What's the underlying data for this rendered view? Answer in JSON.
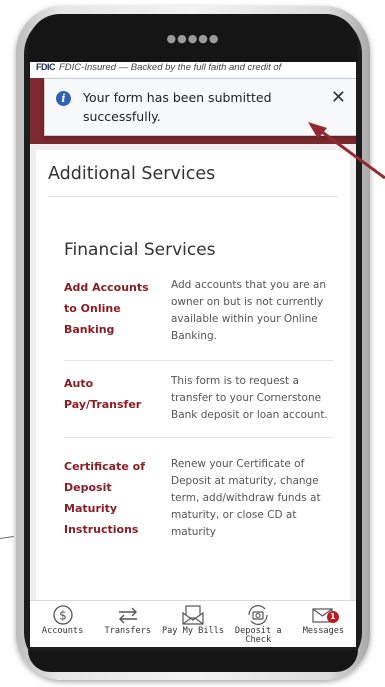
{
  "fdic": {
    "logo": "FDIC",
    "text": "FDIC-Insured — Backed by the full faith and credit of"
  },
  "toast": {
    "message": "Your form has been submitted successfully.",
    "close": "✕"
  },
  "page": {
    "title": "Additional Services",
    "section_title": "Financial Services"
  },
  "services": [
    {
      "name": "Add Accounts to Online Banking",
      "description": "Add accounts that you are an owner on but is not currently available within your Online Banking."
    },
    {
      "name": "Auto Pay/Transfer",
      "description": "This form is to request a transfer to your Cornerstone Bank deposit or loan account."
    },
    {
      "name": "Certificate of Deposit Maturity Instructions",
      "description": "Renew your Certificate of Deposit at maturity, change term, add/withdraw funds at maturity, or close CD at maturity"
    }
  ],
  "tabbar": {
    "accounts": "Accounts",
    "transfers": "Transfers",
    "pay_bills": "Pay My Bills",
    "deposit_check": "Deposit a Check",
    "messages": "Messages",
    "messages_badge": "1"
  },
  "colors": {
    "brand_maroon": "#7c2a2f",
    "link_red": "#8a1e24",
    "info_blue": "#2f62b5",
    "badge_red": "#c0181f"
  }
}
